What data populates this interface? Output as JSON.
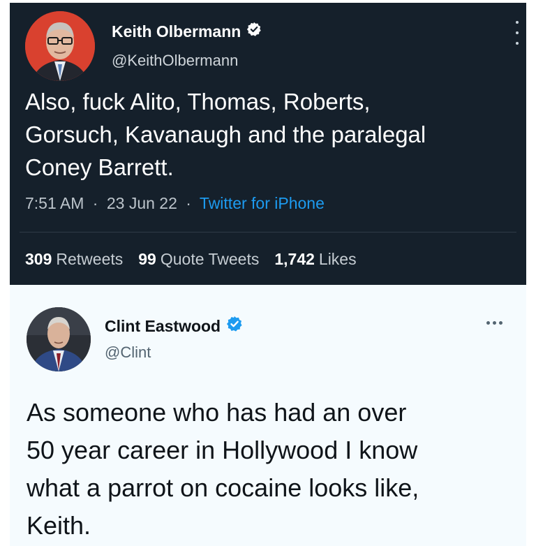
{
  "tweet1": {
    "name": "Keith Olbermann",
    "handle": "@KeithOlbermann",
    "text_lines": [
      "Also, fuck Alito, Thomas, Roberts,",
      "Gorsuch, Kavanaugh and the paralegal",
      "Coney Barrett."
    ],
    "time": "7:51 AM",
    "date": "23 Jun 22",
    "source": "Twitter for iPhone",
    "sep": "·",
    "retweets_count": "309",
    "retweets_label": "Retweets",
    "quotes_count": "99",
    "quotes_label": "Quote Tweets",
    "likes_count": "1,742",
    "likes_label": "Likes",
    "colors": {
      "background": "#15202b",
      "avatar_bg": "#d9412f",
      "link": "#1d9bf0"
    }
  },
  "tweet2": {
    "name": "Clint Eastwood",
    "handle": "@Clint",
    "text_lines": [
      "As someone who has had an over",
      "50 year career in Hollywood I know",
      "what a parrot on cocaine looks like,",
      "Keith."
    ],
    "colors": {
      "background": "#f5fbfe",
      "verified": "#1d9bf0"
    }
  },
  "icons": {
    "verified": "verified-badge-icon",
    "more_vertical": "more-vertical-icon",
    "more_horizontal": "more-horizontal-icon"
  }
}
